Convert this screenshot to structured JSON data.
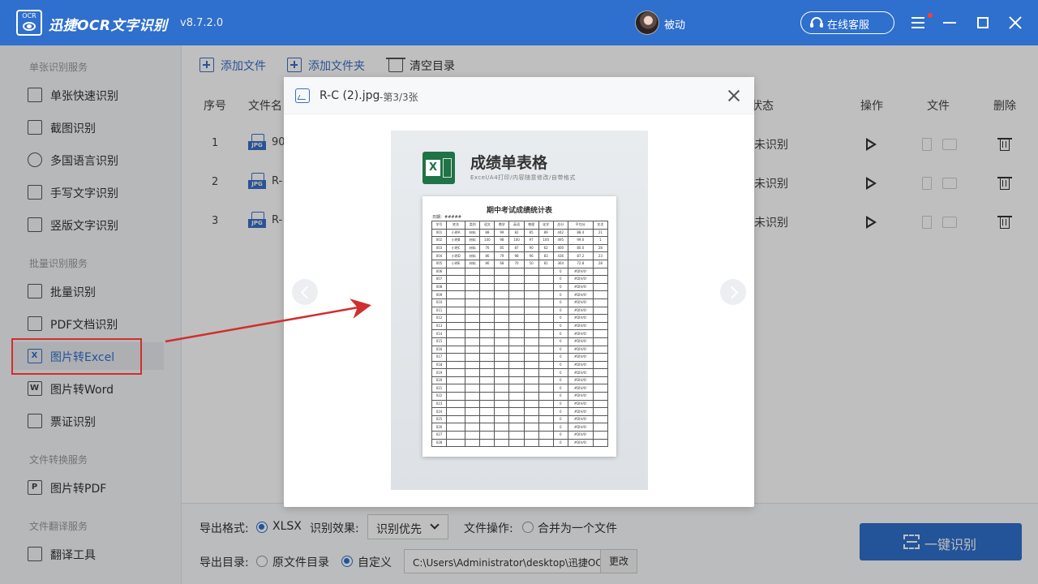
{
  "titlebar": {
    "logo_text": "OCR",
    "app_title": "迅捷OCR文字识别",
    "version": "v8.7.2.0",
    "username": "被动",
    "service_label": "在线客服"
  },
  "sidebar": {
    "sections": {
      "single": "单张识别服务",
      "batch": "批量识别服务",
      "convert": "文件转换服务",
      "translate": "文件翻译服务"
    },
    "items": [
      {
        "label": "单张快速识别",
        "icon": "quick-scan-icon"
      },
      {
        "label": "截图识别",
        "icon": "crop-icon"
      },
      {
        "label": "多国语言识别",
        "icon": "globe-icon"
      },
      {
        "label": "手写文字识别",
        "icon": "pen-icon"
      },
      {
        "label": "竖版文字识别",
        "icon": "vertical-text-icon"
      },
      {
        "label": "批量识别",
        "icon": "batch-icon"
      },
      {
        "label": "PDF文档识别",
        "icon": "pdf-icon"
      },
      {
        "label": "图片转Excel",
        "icon": "excel-icon",
        "letter": "X"
      },
      {
        "label": "图片转Word",
        "icon": "word-icon",
        "letter": "W"
      },
      {
        "label": "票证识别",
        "icon": "card-icon"
      },
      {
        "label": "图片转PDF",
        "icon": "image-pdf-icon",
        "letter": "P"
      },
      {
        "label": "翻译工具",
        "icon": "translate-icon"
      }
    ]
  },
  "toolbar": {
    "add_file": "添加文件",
    "add_folder": "添加文件夹",
    "clear_list": "清空目录"
  },
  "table": {
    "headers": {
      "index": "序号",
      "filename": "文件名",
      "status": "状态",
      "action": "操作",
      "file": "文件",
      "delete": "删除"
    },
    "rows": [
      {
        "index": "1",
        "name": "90",
        "status": "未识别"
      },
      {
        "index": "2",
        "name": "R-",
        "status": "未识别"
      },
      {
        "index": "3",
        "name": "R-",
        "status": "未识别"
      }
    ],
    "file_type_badge": "JPG"
  },
  "bottom": {
    "export_format_label": "导出格式:",
    "export_format_value": "XLSX",
    "effect_label": "识别效果:",
    "effect_value": "识别优先",
    "file_op_label": "文件操作:",
    "merge_label": "合并为一个文件",
    "export_dir_label": "导出目录:",
    "dir_original": "原文件目录",
    "dir_custom": "自定义",
    "path_value": "C:\\Users\\Administrator\\desktop\\迅捷OCR文",
    "change_label": "更改",
    "ocr_button": "一键识别"
  },
  "modal": {
    "file_name": "R-C (2).jpg",
    "page_info": "-第3/3张",
    "preview": {
      "title": "成绩单表格",
      "subtitle": "Excel/A4打印/内容随意修改/自带格式",
      "icon_letter": "X",
      "sheet_title": "期中考试成绩统计表",
      "date_label": "日期：",
      "date_value": "#####",
      "headers": [
        "学号",
        "姓名",
        "类别",
        "语文",
        "数学",
        "英语",
        "物理",
        "化学",
        "总分",
        "平均分",
        "名次"
      ],
      "rows": [
        [
          "001",
          "小明A",
          "材料",
          "88",
          "99",
          "82",
          "85",
          "89",
          "442",
          "88.4",
          "21"
        ],
        [
          "002",
          "小明B",
          "材料",
          "100",
          "98",
          "100",
          "97",
          "100",
          "495",
          "99.0",
          "1"
        ],
        [
          "003",
          "小明C",
          "材料",
          "76",
          "85",
          "87",
          "90",
          "62",
          "400",
          "80.0",
          "28"
        ],
        [
          "004",
          "小明D",
          "材料",
          "86",
          "79",
          "98",
          "96",
          "83",
          "436",
          "87.2",
          "23"
        ],
        [
          "005",
          "小明E",
          "材料",
          "86",
          "68",
          "70",
          "50",
          "81",
          "364",
          "72.8",
          "28"
        ]
      ],
      "empty_ids": [
        "006",
        "007",
        "008",
        "009",
        "010",
        "011",
        "012",
        "013",
        "014",
        "015",
        "016",
        "017",
        "018",
        "019",
        "020",
        "021",
        "022",
        "023",
        "024",
        "025",
        "026",
        "027",
        "028"
      ],
      "empty_total": "0",
      "empty_avg": "#DIV/0!"
    }
  },
  "colors": {
    "accent": "#2f6fcd",
    "highlight_box": "#d12e2e",
    "excel_green": "#1f7346"
  }
}
